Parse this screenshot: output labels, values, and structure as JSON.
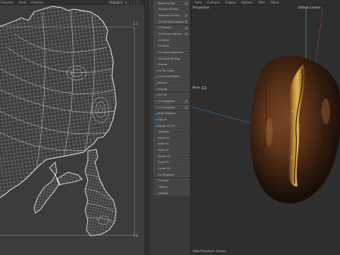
{
  "uv_editor": {
    "menu": [
      "Selection",
      "Panel",
      "Features"
    ],
    "dropdown_value": "Polygons",
    "coord_top": "1.1",
    "coord_bottom": "1.0"
  },
  "tools": [
    {
      "label": "Reset UV Edit",
      "bullet": false,
      "option": true
    },
    {
      "label": "Transfer UV Map",
      "bullet": false,
      "option": false
    },
    {
      "label": "Generate UV Map",
      "bullet": false,
      "option": true
    },
    {
      "label": "UV Edit Tools Options",
      "bullet": false,
      "option": true
    },
    {
      "label": "UV Relaxer",
      "bullet": false,
      "option": true
    },
    {
      "label": "UV Relaxer Options",
      "bullet": false,
      "option": true
    },
    {
      "label": "UV Stitch",
      "bullet": false,
      "option": false
    },
    {
      "label": "UV Mirror",
      "bullet": false,
      "option": false
    },
    {
      "label": "UV Island Alignment",
      "bullet": false,
      "option": false
    },
    {
      "label": "UV Island Packing",
      "bullet": false,
      "option": false
    },
    {
      "label": "Unwrap",
      "bullet": false,
      "option": false
    },
    {
      "label": "UV Pin Cutter",
      "bullet": true,
      "option": false
    },
    {
      "label": "UV Pinned Edges",
      "bullet": true,
      "option": false
    },
    {
      "label": "Relaxer",
      "bullet": true,
      "option": false
    },
    {
      "label": "Unwrap",
      "bullet": true,
      "option": false
    },
    {
      "label": "UV Cut",
      "bullet": true,
      "option": false
    },
    {
      "label": "UV Straighten",
      "bullet": true,
      "option": true
    },
    {
      "label": "UV Straighten",
      "bullet": true,
      "option": true
    },
    {
      "label": "Align Polygons",
      "bullet": true,
      "option": false
    },
    {
      "label": "Flip UV",
      "bullet": true,
      "option": false
    },
    {
      "label": "Rotate UV 90°",
      "bullet": true,
      "option": false
    },
    {
      "label": "Translate",
      "bullet": false,
      "option": false
    },
    {
      "label": "Mirror UV",
      "bullet": false,
      "option": false
    },
    {
      "label": "Scale UV",
      "bullet": false,
      "option": false
    },
    {
      "label": "Scale UV",
      "bullet": false,
      "option": false
    },
    {
      "label": "Rotate UV",
      "bullet": false,
      "option": false
    },
    {
      "label": "Scale UV",
      "bullet": false,
      "option": false
    },
    {
      "label": "Center UV",
      "bullet": false,
      "option": false
    },
    {
      "label": "UV Snapping",
      "bullet": false,
      "option": false
    },
    {
      "label": "UV Scale",
      "bullet": false,
      "option": false
    },
    {
      "label": "Options",
      "bullet": false,
      "option": false
    },
    {
      "label": "Settings",
      "bullet": false,
      "option": false
    }
  ],
  "viewport": {
    "menu": [
      "View",
      "Cameras",
      "Display",
      "Options",
      "Filter",
      "Panel"
    ],
    "view_name": "Perspective",
    "camera_name": "Default Camera",
    "hud_label": "Move",
    "status": "View Transform: Screen"
  },
  "colors": {
    "panel": "#3c3c3c",
    "viewport": "#2e2e2e",
    "axis_y": "#5ad17a",
    "axis_x": "#d14a4a",
    "axis_z": "#3a86c4",
    "bean_dark": "#3a2010",
    "bean_mid": "#6a3a1c",
    "crease": "#c8973e"
  }
}
